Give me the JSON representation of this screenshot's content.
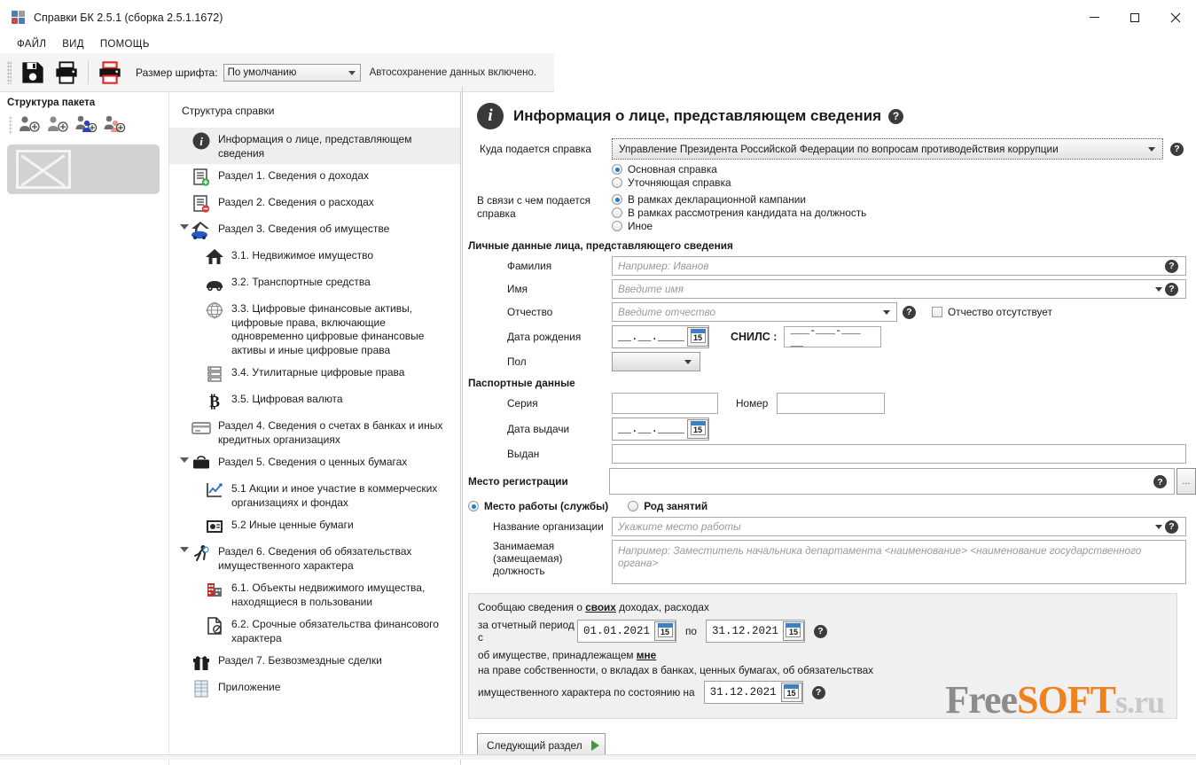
{
  "window": {
    "title": "Справки БК 2.5.1 (сборка 2.5.1.1672)",
    "minimize": "—",
    "maximize": "□",
    "close": "✕"
  },
  "menu": {
    "items": [
      "ФАЙЛ",
      "ВИД",
      "ПОМОЩЬ"
    ]
  },
  "toolbar": {
    "save_icon": "floppy-disk-icon",
    "print_icon": "printer-icon",
    "print_red_icon": "printer-red-icon",
    "font_size_label": "Размер шрифта:",
    "font_size_value": "По умолчанию",
    "autosave_status": "Автосохранение данных включено."
  },
  "package_panel": {
    "title": "Структура пакета",
    "icons": [
      "add-person-icon",
      "add-person-icon",
      "add-person-blue-icon",
      "add-person-red-icon"
    ]
  },
  "tree": {
    "title": "Структура справки",
    "nodes": [
      {
        "label": "Информация о лице, представляющем сведения",
        "level": 0,
        "icon": "info-icon",
        "selected": true,
        "expander": false
      },
      {
        "label": "Раздел 1. Сведения о доходах",
        "level": 0,
        "icon": "list-green-plus-icon",
        "selected": false,
        "expander": false
      },
      {
        "label": "Раздел 2. Сведения о расходах",
        "level": 0,
        "icon": "list-red-minus-icon",
        "selected": false,
        "expander": false
      },
      {
        "label": "Раздел 3. Сведения об имуществе",
        "level": 0,
        "icon": "house-car-icon",
        "selected": false,
        "expander": true
      },
      {
        "label": "3.1. Недвижимое имущество",
        "level": 1,
        "icon": "house-icon",
        "selected": false,
        "expander": false
      },
      {
        "label": "3.2. Транспортные средства",
        "level": 1,
        "icon": "car-icon",
        "selected": false,
        "expander": false
      },
      {
        "label": "3.3. Цифровые финансовые активы, цифровые права, включающие одновременно цифровые финансовые активы и иные цифровые права",
        "level": 1,
        "icon": "network-globe-icon",
        "selected": false,
        "expander": false
      },
      {
        "label": "3.4. Утилитарные цифровые права",
        "level": 1,
        "icon": "server-rack-icon",
        "selected": false,
        "expander": false
      },
      {
        "label": "3.5. Цифровая валюта",
        "level": 1,
        "icon": "bitcoin-icon",
        "selected": false,
        "expander": false
      },
      {
        "label": "Раздел 4. Сведения о счетах в банках и иных кредитных организациях",
        "level": 0,
        "icon": "credit-card-icon",
        "selected": false,
        "expander": false
      },
      {
        "label": "Раздел 5. Сведения о ценных бумагах",
        "level": 0,
        "icon": "briefcase-icon",
        "selected": false,
        "expander": true
      },
      {
        "label": "5.1 Акции и иное участие в коммерческих организациях и фондах",
        "level": 1,
        "icon": "chart-line-icon",
        "selected": false,
        "expander": false
      },
      {
        "label": "5.2 Иные ценные бумаги",
        "level": 1,
        "icon": "certificate-icon",
        "selected": false,
        "expander": false
      },
      {
        "label": "Раздел 6. Сведения об обязательствах имущественного характера",
        "level": 0,
        "icon": "runner-icon",
        "selected": false,
        "expander": true
      },
      {
        "label": "6.1. Объекты недвижимого имущества, находящиеся в пользовании",
        "level": 1,
        "icon": "buildings-icon",
        "selected": false,
        "expander": false
      },
      {
        "label": "6.2. Срочные обязательства финансового характера",
        "level": 1,
        "icon": "document-pen-icon",
        "selected": false,
        "expander": false
      },
      {
        "label": "Раздел 7. Безвозмездные сделки",
        "level": 0,
        "icon": "gift-icon",
        "selected": false,
        "expander": false
      },
      {
        "label": "Приложение",
        "level": 0,
        "icon": "spreadsheet-icon",
        "selected": false,
        "expander": false
      }
    ]
  },
  "form": {
    "title": "Информация о лице, представляющем сведения",
    "where_label": "Куда подается справка",
    "where_value": "Управление Президента Российской Федерации по вопросам противодействия коррупции",
    "cert_type_options": [
      {
        "label": "Основная справка",
        "checked": true
      },
      {
        "label": "Уточняющая справка",
        "checked": false
      }
    ],
    "reason_label": "В связи с чем подается справка",
    "reason_options": [
      {
        "label": "В рамках декларационной кампании",
        "checked": true
      },
      {
        "label": "В рамках рассмотрения кандидата на должность",
        "checked": false
      },
      {
        "label": "Иное",
        "checked": false
      }
    ],
    "personal_header": "Личные данные лица, представляющего сведения",
    "surname_label": "Фамилия",
    "surname_placeholder": "Например: Иванов",
    "firstname_label": "Имя",
    "firstname_placeholder": "Введите имя",
    "patronymic_label": "Отчество",
    "patronymic_placeholder": "Введите отчество",
    "no_patronymic_label": "Отчество отсутствует",
    "no_patronymic_checked": false,
    "birthdate_label": "Дата рождения",
    "birthdate_value": "__.__.____",
    "snils_label": "СНИЛС :",
    "snils_value": "___-___-___ __",
    "gender_label": "Пол",
    "gender_value": "",
    "passport_header": "Паспортные данные",
    "series_label": "Серия",
    "series_value": "",
    "number_label": "Номер",
    "number_value": "",
    "issue_date_label": "Дата выдачи",
    "issue_date_value": "__.__.____",
    "issued_by_label": "Выдан",
    "issued_by_value": "",
    "registration_label": "Место регистрации",
    "registration_value": "",
    "browse_button": "...",
    "employment_options": [
      {
        "label": "Место работы (службы)",
        "checked": true
      },
      {
        "label": "Род занятий",
        "checked": false
      }
    ],
    "org_label": "Название организации",
    "org_placeholder": "Укажите место работы",
    "position_label": "Занимаемая (замещаемая) должность",
    "position_label_lines": [
      "Занимаемая",
      "(замещаемая)",
      "должность"
    ],
    "position_placeholder": "Например: Заместитель начальника департамента <наименование> <наименование государственного органа>",
    "calendar_icon": "calendar-icon",
    "help_icon": "help-circle-icon"
  },
  "period": {
    "line1_pre": "Сообщаю сведения о ",
    "line1_em": "своих",
    "line1_post": " доходах, расходах",
    "line2_label": "за отчетный период с",
    "date_from": "01.01.2021",
    "to_label": "по",
    "date_to": "31.12.2021",
    "line3_pre": "об имуществе, принадлежащем ",
    "line3_em": "мне",
    "line4": "на праве собственности, о вкладах в банках, ценных бумагах, об обязательствах",
    "line5_label": "имущественного характера по состоянию на",
    "date_as_of": "31.12.2021"
  },
  "footer": {
    "next_button": "Следующий раздел"
  },
  "watermark": {
    "part1": "Free",
    "part2": "SOFT",
    "part3": "s.ru"
  },
  "colors": {
    "accent_blue": "#1a7fd4",
    "orange": "#f0821e",
    "gray": "#8c8c8c",
    "panel": "#f0f0f0"
  }
}
